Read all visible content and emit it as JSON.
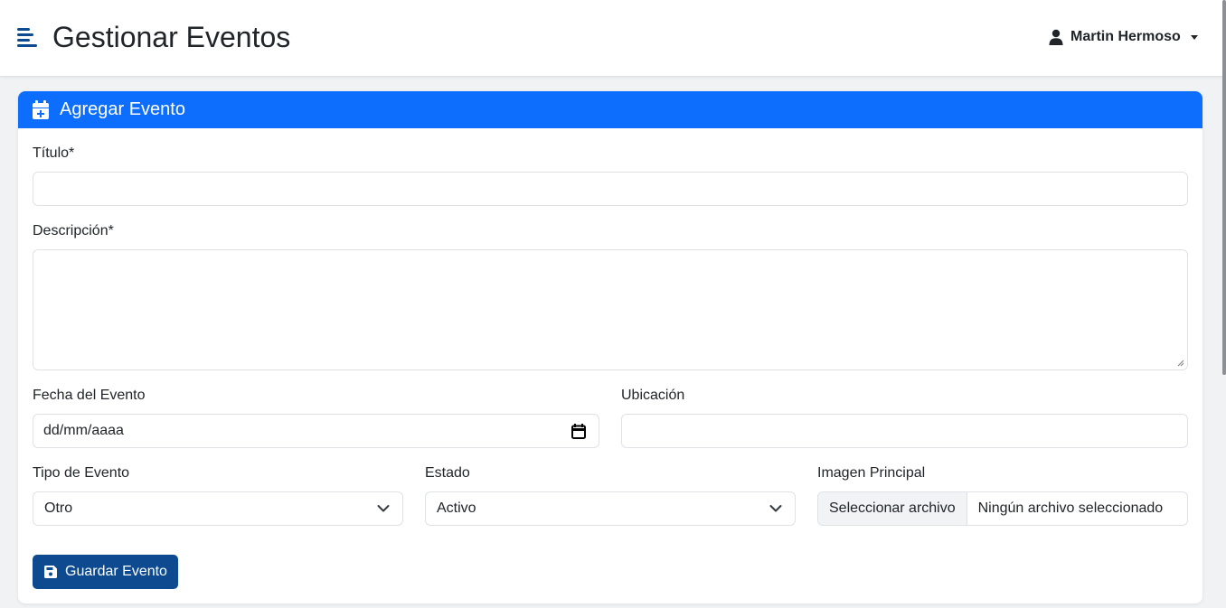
{
  "header": {
    "title": "Gestionar Eventos",
    "user_name": "Martin Hermoso"
  },
  "form": {
    "card_title": "Agregar Evento",
    "title_label": "Título*",
    "title_value": "",
    "description_label": "Descripción*",
    "description_value": "",
    "date_label": "Fecha del Evento",
    "date_value": "dd/mm/aaaa",
    "location_label": "Ubicación",
    "location_value": "",
    "type_label": "Tipo de Evento",
    "type_value": "Otro",
    "status_label": "Estado",
    "status_value": "Activo",
    "image_label": "Imagen Principal",
    "file_button": "Seleccionar archivo",
    "file_status": "Ningún archivo seleccionado",
    "save_label": "Guardar Evento"
  },
  "colors": {
    "primary": "#0d6efd",
    "primary_dark": "#0d4a8f",
    "background": "#f1f2f4"
  },
  "icons": {
    "menu": "menu-toggle-icon",
    "user": "user-icon",
    "card_header": "calendar-plus-icon",
    "save": "floppy-disk-icon",
    "date": "calendar-icon",
    "select": "chevron-down-icon"
  }
}
